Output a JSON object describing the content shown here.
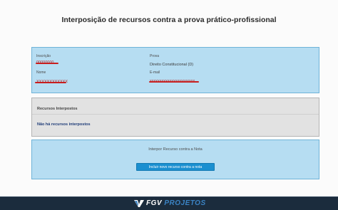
{
  "page": {
    "title": "Interposição de recursos contra a prova prático-profissional"
  },
  "candidate": {
    "inscricao_label": "Inscrição",
    "inscricao_value": "00000000",
    "prova_label": "Prova",
    "prova_value": "Direito Constitucional (D)",
    "nome_label": "Nome",
    "nome_value": "XXXXXXXXXXXX",
    "email_label": "E-mail",
    "email_value": "xxxxxxxxxxxxxxxxxxxxxxx"
  },
  "resources": {
    "title": "Recursos Interpostos",
    "empty_message": "Não há recursos interpostos"
  },
  "action": {
    "caption": "Interpor Recurso contra a Nota",
    "button_label": "Incluir novo recurso contra a nota"
  },
  "footer": {
    "brand_prefix": "FGV",
    "brand_suffix": "PROJETOS"
  },
  "colors": {
    "info_panel_bg": "#b6ddf2",
    "resources_panel_bg": "#e2e2e2",
    "button_bg": "#1a8fd0",
    "redaction": "#c81e1e",
    "footer_bg": "#1b2c3d"
  }
}
